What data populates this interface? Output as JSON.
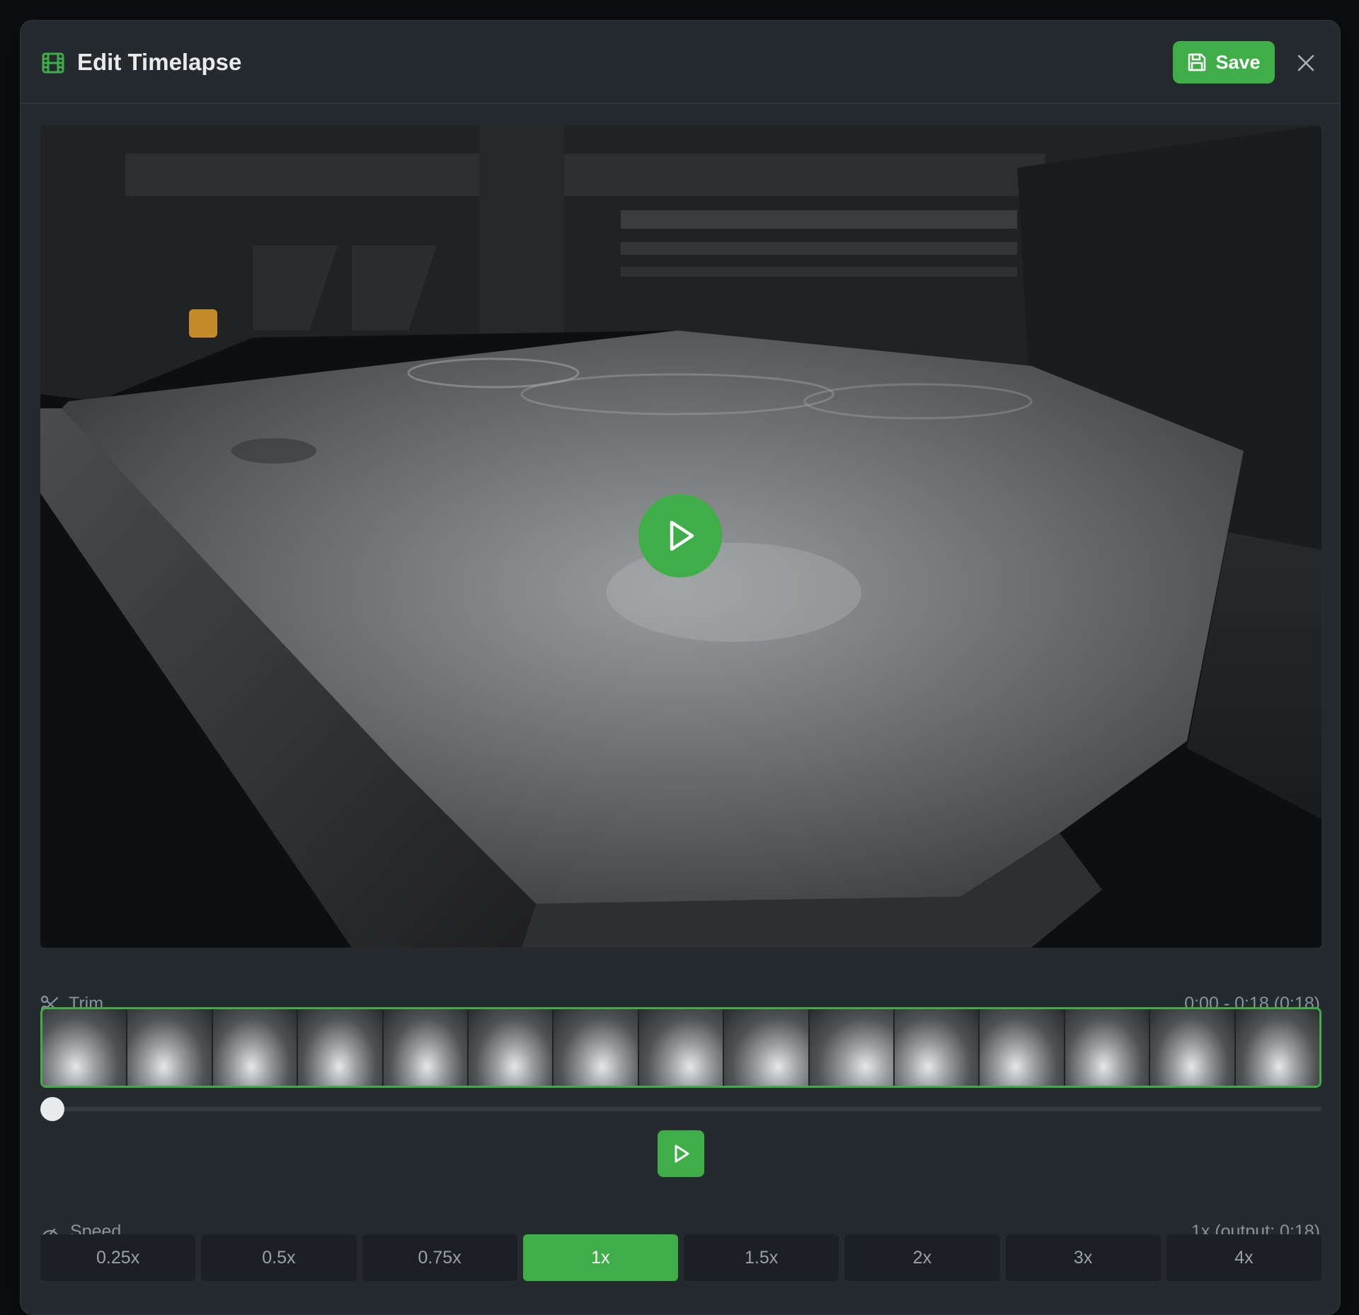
{
  "header": {
    "title": "Edit Timelapse",
    "title_icon": "film-icon",
    "save_label": "Save",
    "save_icon": "floppy-disk-icon",
    "close_icon": "close-icon"
  },
  "video": {
    "content": "3D printer build plate camera view",
    "play_icon": "play-icon"
  },
  "trim": {
    "label": "Trim",
    "icon": "scissors-icon",
    "range_text": "0:00 - 0:18 (0:18)",
    "frame_count": 15,
    "scrub_position": 0
  },
  "playback": {
    "play_icon": "play-icon"
  },
  "speed": {
    "label": "Speed",
    "icon": "gauge-icon",
    "summary": "1x (output: 0:18)",
    "options": [
      "0.25x",
      "0.5x",
      "0.75x",
      "1x",
      "1.5x",
      "2x",
      "3x",
      "4x"
    ],
    "selected": "1x"
  },
  "colors": {
    "accent": "#3fae48",
    "panel": "#252a2e",
    "button_bg": "#1c2024",
    "muted_text": "#8b939a"
  }
}
